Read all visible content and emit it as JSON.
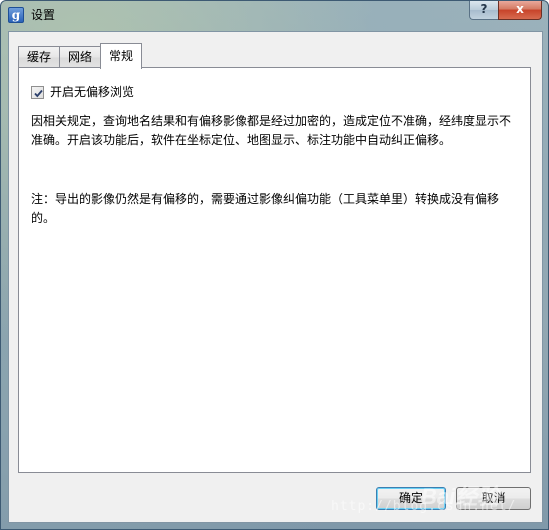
{
  "window": {
    "title": "设置",
    "app_icon_glyph": "g",
    "help_label": "?",
    "close_label": "x"
  },
  "tabs": [
    {
      "label": "缓存",
      "active": false
    },
    {
      "label": "网络",
      "active": false
    },
    {
      "label": "常规",
      "active": true
    }
  ],
  "general": {
    "checkbox_label": "开启无偏移浏览",
    "checkbox_checked": true,
    "paragraph1": "因相关规定，查询地名结果和有偏移影像都是经过加密的，造成定位不准确，经纬度显示不准确。开启该功能后，软件在坐标定位、地图显示、标注功能中自动纠正偏移。",
    "paragraph2": "注：导出的影像仍然是有偏移的，需要通过影像纠偏功能（工具菜单里）转换成没有偏移的。"
  },
  "buttons": {
    "ok_label": "确定",
    "cancel_label": "取消"
  },
  "watermark": {
    "text": "http://blog.csdn.net/",
    "logo": "Bai经验"
  },
  "colors": {
    "close_button": "#c7432a",
    "panel_background": "#ffffff",
    "dialog_background": "#f0f0f0"
  }
}
